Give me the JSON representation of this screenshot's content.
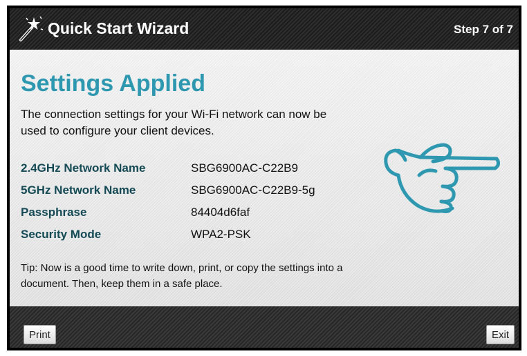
{
  "header": {
    "title": "Quick Start Wizard",
    "step": "Step 7 of 7",
    "icon": "magic-wand-icon"
  },
  "main": {
    "heading": "Settings Applied",
    "intro": "The connection settings for your Wi-Fi network can now be used to configure your client devices.",
    "settings": [
      {
        "label": "2.4GHz Network Name",
        "value": "SBG6900AC-C22B9"
      },
      {
        "label": "5GHz Network Name",
        "value": "SBG6900AC-C22B9-5g"
      },
      {
        "label": "Passphrase",
        "value": "84404d6faf"
      },
      {
        "label": "Security Mode",
        "value": "WPA2-PSK"
      }
    ],
    "tip": "Tip: Now is a good time to write down, print, or copy the settings into a document. Then, keep them in a safe place.",
    "pointer_icon": "pointing-hand-icon"
  },
  "footer": {
    "print_label": "Print",
    "exit_label": "Exit"
  },
  "colors": {
    "accent": "#2e98b0",
    "label": "#134a55",
    "bar": "#262626"
  }
}
